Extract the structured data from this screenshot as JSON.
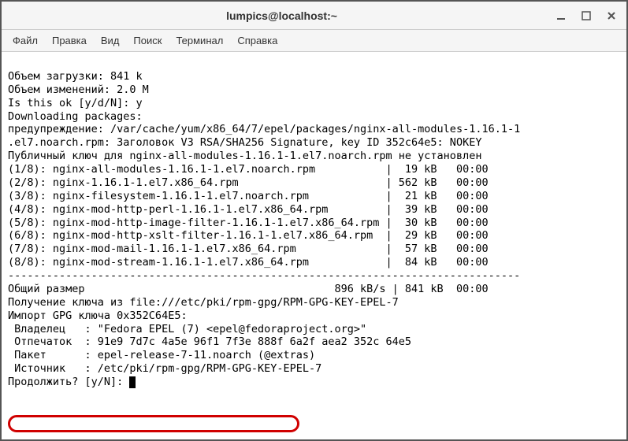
{
  "window": {
    "title": "lumpics@localhost:~"
  },
  "menu": {
    "file": "Файл",
    "edit": "Правка",
    "view": "Вид",
    "search": "Поиск",
    "terminal": "Терминал",
    "help": "Справка"
  },
  "terminal": {
    "lines": [
      "Объем загрузки: 841 k",
      "Объем изменений: 2.0 M",
      "Is this ok [y/d/N]: y",
      "Downloading packages:",
      "предупреждение: /var/cache/yum/x86_64/7/epel/packages/nginx-all-modules-1.16.1-1",
      ".el7.noarch.rpm: Заголовок V3 RSA/SHA256 Signature, key ID 352c64e5: NOKEY",
      "Публичный ключ для nginx-all-modules-1.16.1-1.el7.noarch.rpm не установлен",
      "(1/8): nginx-all-modules-1.16.1-1.el7.noarch.rpm           |  19 kB   00:00",
      "(2/8): nginx-1.16.1-1.el7.x86_64.rpm                       | 562 kB   00:00",
      "(3/8): nginx-filesystem-1.16.1-1.el7.noarch.rpm            |  21 kB   00:00",
      "(4/8): nginx-mod-http-perl-1.16.1-1.el7.x86_64.rpm         |  39 kB   00:00",
      "(5/8): nginx-mod-http-image-filter-1.16.1-1.el7.x86_64.rpm |  30 kB   00:00",
      "(6/8): nginx-mod-http-xslt-filter-1.16.1-1.el7.x86_64.rpm  |  29 kB   00:00",
      "(7/8): nginx-mod-mail-1.16.1-1.el7.x86_64.rpm              |  57 kB   00:00",
      "(8/8): nginx-mod-stream-1.16.1-1.el7.x86_64.rpm            |  84 kB   00:00",
      "--------------------------------------------------------------------------------",
      "Общий размер                                       896 kB/s | 841 kB  00:00",
      "Получение ключа из file:///etc/pki/rpm-gpg/RPM-GPG-KEY-EPEL-7",
      "Импорт GPG ключа 0x352C64E5:",
      " Владелец   : \"Fedora EPEL (7) <epel@fedoraproject.org>\"",
      " Отпечаток  : 91e9 7d7c 4a5e 96f1 7f3e 888f 6a2f aea2 352c 64e5",
      " Пакет      : epel-release-7-11.noarch (@extras)",
      " Источник   : /etc/pki/rpm-gpg/RPM-GPG-KEY-EPEL-7"
    ],
    "prompt": "Продолжить? [y/N]: "
  }
}
